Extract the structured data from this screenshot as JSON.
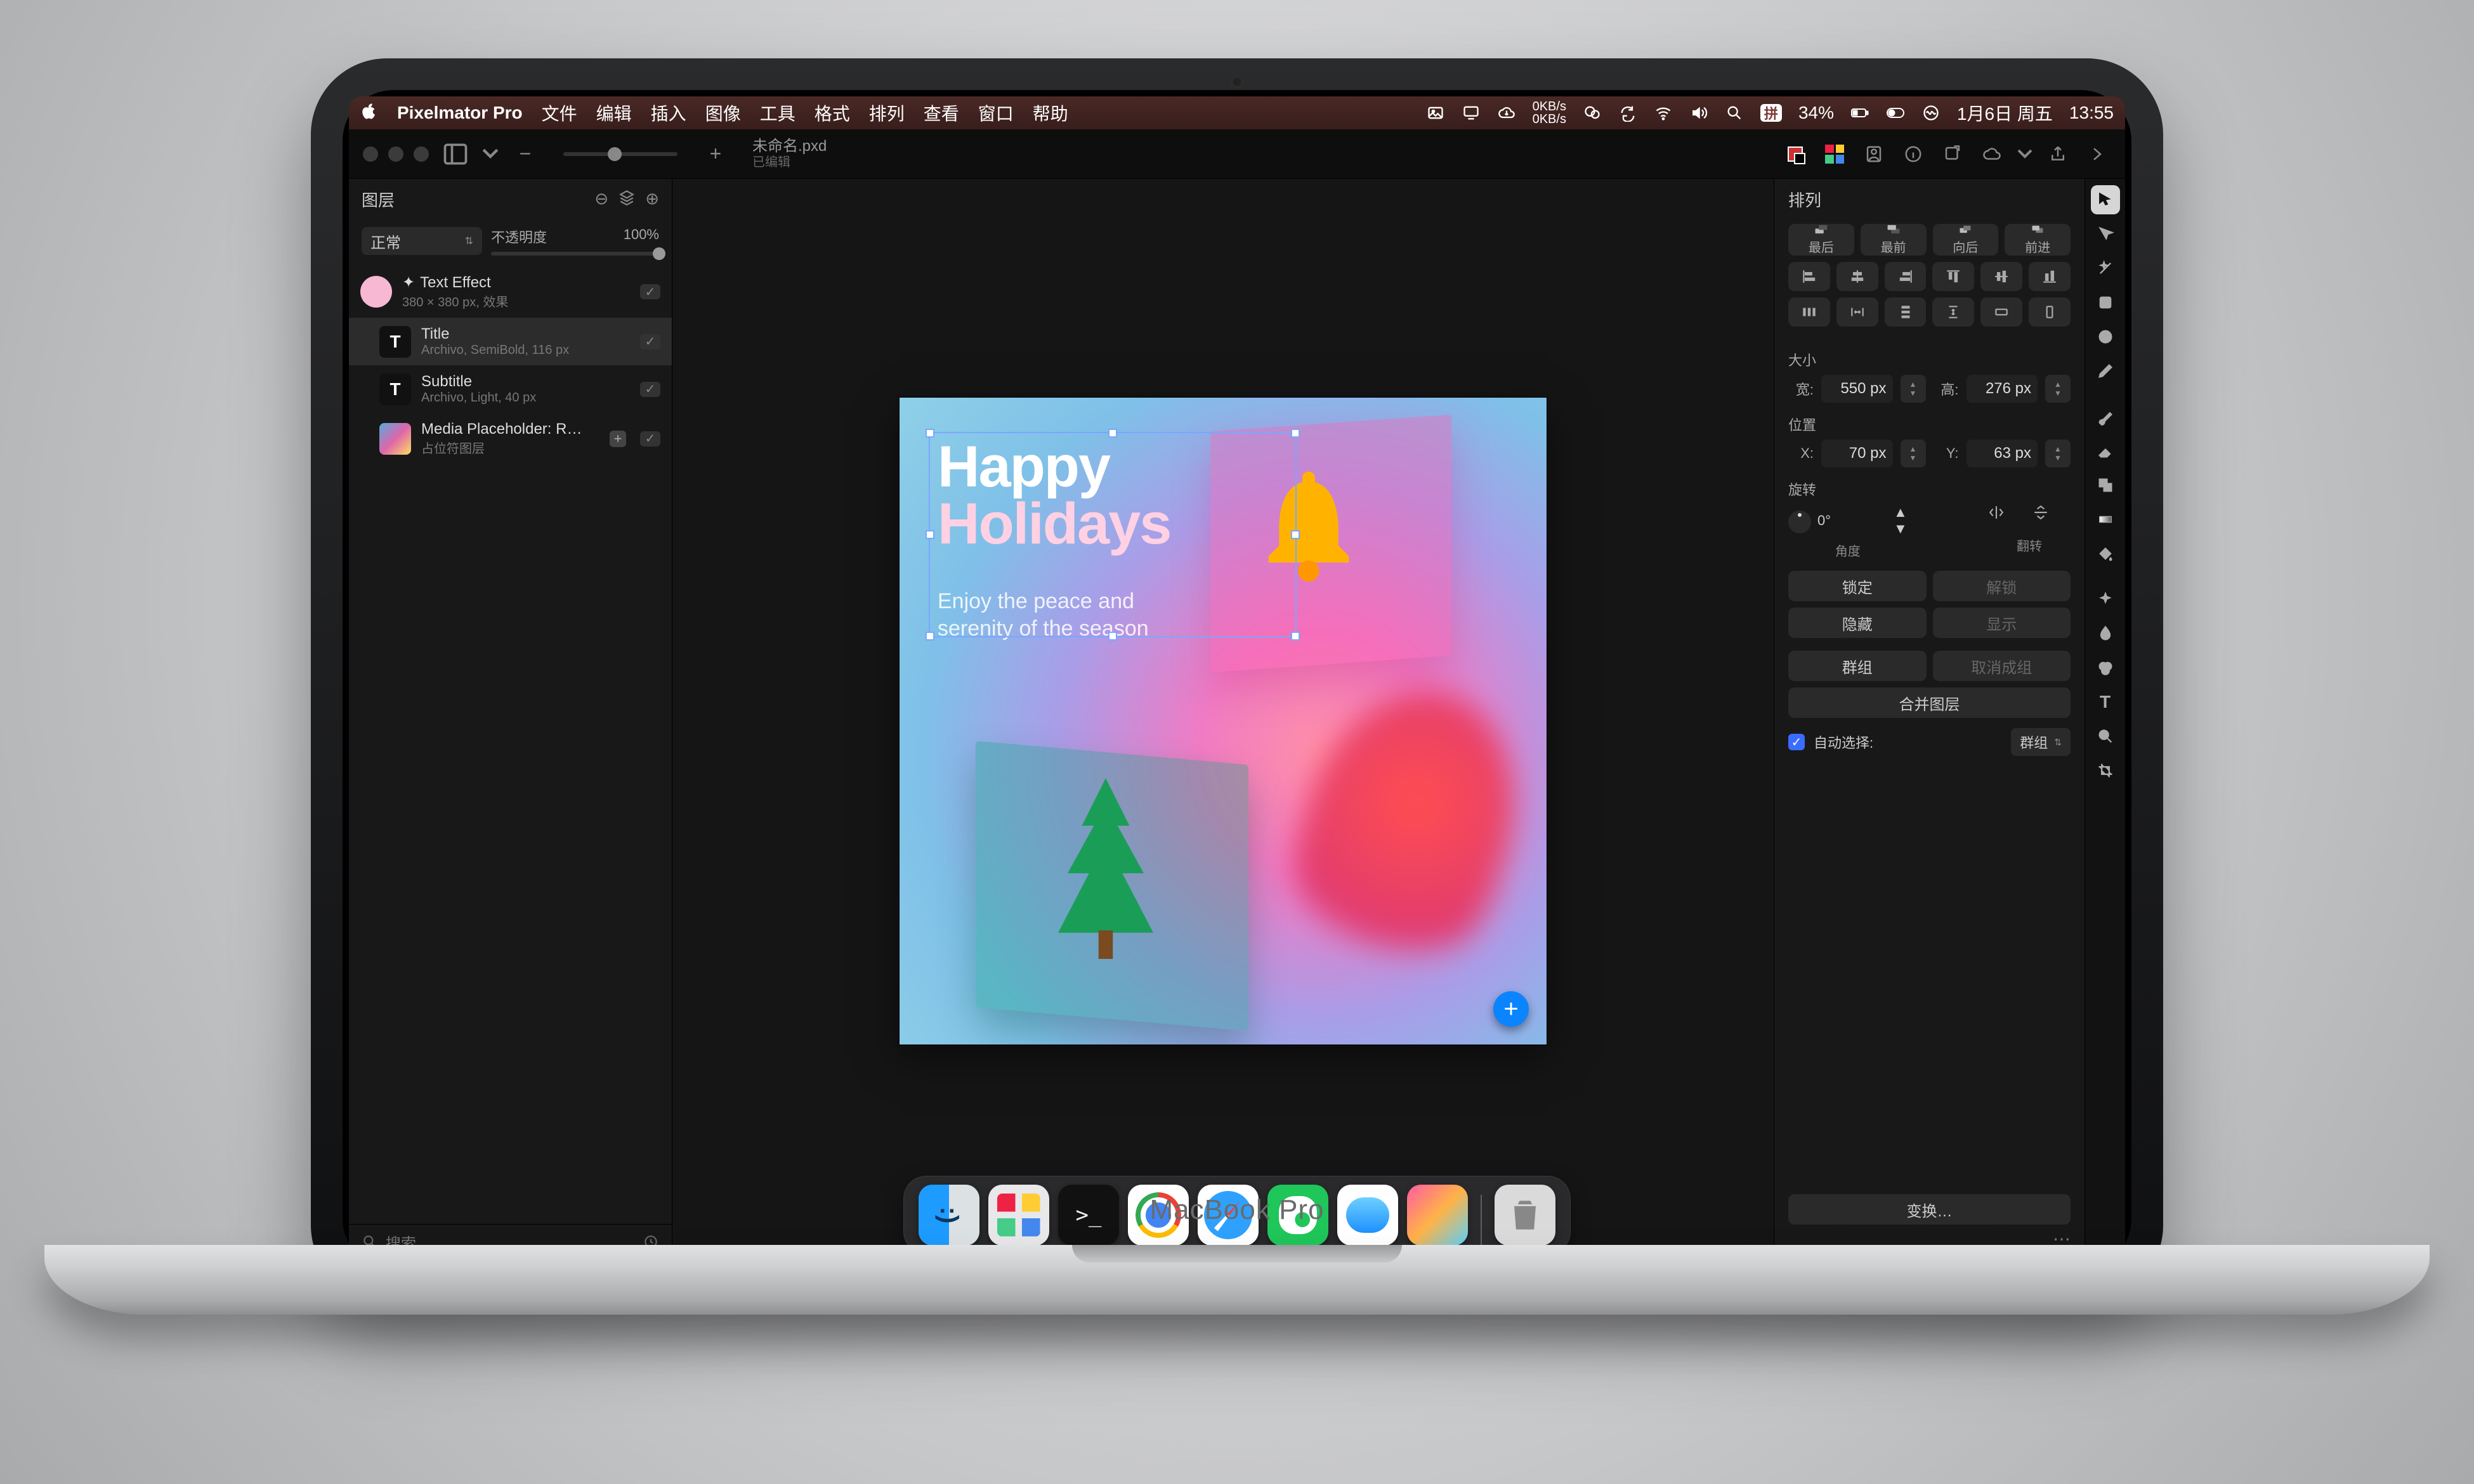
{
  "hardware": {
    "label": "MacBook Pro"
  },
  "menubar": {
    "apple": "apple-logo",
    "app_name": "Pixelmator Pro",
    "items": [
      "文件",
      "编辑",
      "插入",
      "图像",
      "工具",
      "格式",
      "排列",
      "查看",
      "窗口",
      "帮助"
    ],
    "status": {
      "net_up": "0KB/s",
      "net_down": "0KB/s",
      "battery_pct": "34%",
      "input_method": "拼",
      "date": "1月6日 周五",
      "time": "13:55"
    }
  },
  "window": {
    "document_title": "未命名.pxd",
    "document_subtitle": "已编辑"
  },
  "layers_panel": {
    "title": "图层",
    "blend_mode": "正常",
    "opacity_label": "不透明度",
    "opacity_value": "100%",
    "items": [
      {
        "id": "fx",
        "name": "Text Effect",
        "sub": "380 × 380 px, 效果",
        "thumb": "circle",
        "visible": true,
        "selected": false
      },
      {
        "id": "tt",
        "name": "Title",
        "sub": "Archivo, SemiBold, 116 px",
        "thumb": "text",
        "glyph": "T",
        "visible": true,
        "selected": true,
        "indent": true
      },
      {
        "id": "st",
        "name": "Subtitle",
        "sub": "Archivo, Light, 40 px",
        "thumb": "text",
        "glyph": "T",
        "visible": true,
        "selected": false,
        "indent": true
      },
      {
        "id": "mp",
        "name": "Media Placeholder: R…",
        "sub": "占位符图层",
        "thumb": "img",
        "visible": true,
        "selected": false,
        "indent": true,
        "badge": "+"
      }
    ],
    "search_placeholder": "搜索"
  },
  "canvas": {
    "title_line1": "Happy",
    "title_line2": "Holidays",
    "subtitle_line1": "Enjoy the peace and",
    "subtitle_line2": "serenity of the season"
  },
  "inspector": {
    "title": "排列",
    "order": {
      "back": "最后",
      "front": "最前",
      "backward": "向后",
      "forward": "前进"
    },
    "size": {
      "label": "大小",
      "w_label": "宽:",
      "w": "550 px",
      "h_label": "高:",
      "h": "276 px"
    },
    "position": {
      "label": "位置",
      "x_label": "X:",
      "x": "70 px",
      "y_label": "Y:",
      "y": "63 px"
    },
    "rotation": {
      "label": "旋转",
      "angle": "0°",
      "angle_label": "角度",
      "flip_label": "翻转"
    },
    "lock": "锁定",
    "unlock": "解锁",
    "hide": "隐藏",
    "show": "显示",
    "group": "群组",
    "ungroup": "取消成组",
    "merge": "合并图层",
    "autoselect_label": "自动选择:",
    "autoselect_value": "群组",
    "transform": "变换…"
  },
  "toolrail": [
    "arrow-select",
    "lasso",
    "magic-wand",
    "crop",
    "rectangle",
    "ellipse",
    "pen",
    "brush",
    "eraser",
    "clone",
    "gradient",
    "paint-bucket",
    "sparkle",
    "blur",
    "adjust-color",
    "text",
    "magnifier",
    "crop-alt"
  ],
  "dock": {
    "apps": [
      "finder",
      "launchpad",
      "terminal",
      "chrome",
      "safari",
      "wechat",
      "icloud",
      "pixelmator"
    ],
    "trash": "trash"
  }
}
